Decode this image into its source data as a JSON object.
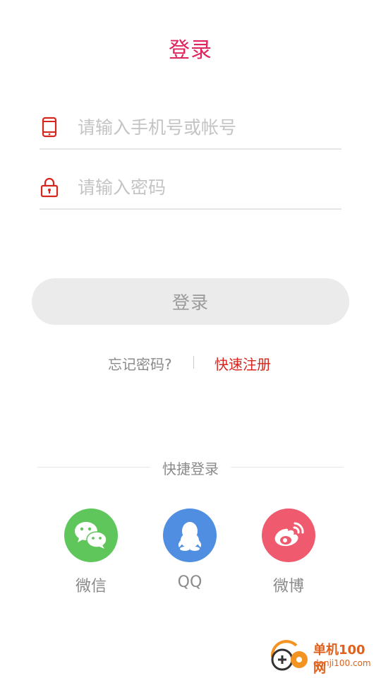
{
  "header": {
    "title": "登录"
  },
  "form": {
    "account_placeholder": "请输入手机号或帐号",
    "password_placeholder": "请输入密码",
    "login_button": "登录"
  },
  "links": {
    "forgot_password": "忘记密码?",
    "register": "快速注册"
  },
  "quick_login": {
    "title": "快捷登录",
    "items": [
      {
        "label": "微信",
        "icon": "wechat-icon",
        "color": "#5fc65c"
      },
      {
        "label": "QQ",
        "icon": "qq-icon",
        "color": "#4f8ee0"
      },
      {
        "label": "微博",
        "icon": "weibo-icon",
        "color": "#f05a6e"
      }
    ]
  },
  "watermark": {
    "title": "单机100网",
    "url": "danji100.com"
  },
  "colors": {
    "accent": "#e0245e",
    "link_red": "#d6261e",
    "button_bg": "#ebebeb"
  }
}
